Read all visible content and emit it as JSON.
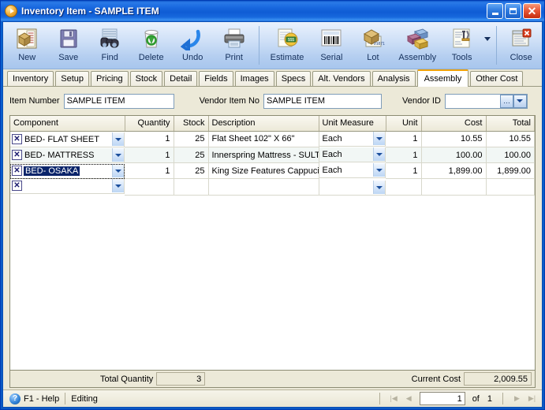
{
  "window": {
    "title": "Inventory Item - SAMPLE ITEM",
    "icon": "app-orange-play-icon",
    "buttons": {
      "minimize": "_",
      "maximize": "□",
      "close": "✕"
    }
  },
  "toolbar": {
    "items": [
      {
        "label": "New",
        "icon": "new-document-box-icon"
      },
      {
        "label": "Save",
        "icon": "floppy-disk-icon"
      },
      {
        "label": "Find",
        "icon": "binoculars-icon"
      },
      {
        "label": "Delete",
        "icon": "recycle-bin-icon"
      },
      {
        "label": "Undo",
        "icon": "undo-arrow-icon"
      },
      {
        "label": "Print",
        "icon": "printer-icon"
      },
      {
        "label": "Estimate",
        "icon": "estimate-money-icon"
      },
      {
        "label": "Serial",
        "icon": "barcode-icon"
      },
      {
        "label": "Lot",
        "icon": "lot-box-icon"
      },
      {
        "label": "Assembly",
        "icon": "assembly-blocks-icon"
      },
      {
        "label": "Tools",
        "icon": "tools-wrench-icon"
      },
      {
        "label": "Close",
        "icon": "close-window-icon"
      }
    ],
    "dropdown_caret": "chevron-down-icon"
  },
  "tabs": [
    {
      "label": "Inventory",
      "active": false
    },
    {
      "label": "Setup",
      "active": false
    },
    {
      "label": "Pricing",
      "active": false
    },
    {
      "label": "Stock",
      "active": false
    },
    {
      "label": "Detail",
      "active": false
    },
    {
      "label": "Fields",
      "active": false
    },
    {
      "label": "Images",
      "active": false
    },
    {
      "label": "Specs",
      "active": false
    },
    {
      "label": "Alt. Vendors",
      "active": false
    },
    {
      "label": "Analysis",
      "active": false
    },
    {
      "label": "Assembly",
      "active": true
    },
    {
      "label": "Other Cost",
      "active": false
    }
  ],
  "fields": {
    "item_number_label": "Item Number",
    "item_number_value": "SAMPLE ITEM",
    "vendor_item_label": "Vendor Item No",
    "vendor_item_value": "SAMPLE ITEM",
    "vendor_id_label": "Vendor ID",
    "vendor_id_value": "",
    "vendor_id_lookup": "…",
    "vendor_id_chevron": "chevron-down-icon"
  },
  "grid": {
    "columns": [
      {
        "label": "Component",
        "align": "left"
      },
      {
        "label": "Quantity",
        "align": "right"
      },
      {
        "label": "Stock",
        "align": "right"
      },
      {
        "label": "Description",
        "align": "left"
      },
      {
        "label": "Unit Measure",
        "align": "left"
      },
      {
        "label": "Unit",
        "align": "right"
      },
      {
        "label": "Cost",
        "align": "right"
      },
      {
        "label": "Total",
        "align": "right"
      }
    ],
    "delete_glyph": "✕",
    "rows": [
      {
        "component": "BED- FLAT SHEET",
        "quantity": "1",
        "stock": "25",
        "description": "Flat Sheet 102\" X 66\"",
        "unit_measure": "Each",
        "unit": "1",
        "cost": "10.55",
        "total": "10.55",
        "selected": false
      },
      {
        "component": "BED- MATTRESS",
        "quantity": "1",
        "stock": "25",
        "description": "Innerspring Mattress - SULTA",
        "unit_measure": "Each",
        "unit": "1",
        "cost": "100.00",
        "total": "100.00",
        "selected": false
      },
      {
        "component": "BED- OSAKA",
        "quantity": "1",
        "stock": "25",
        "description": "King Size Features Cappucino",
        "unit_measure": "Each",
        "unit": "1",
        "cost": "1,899.00",
        "total": "1,899.00",
        "selected": true
      },
      {
        "component": "",
        "quantity": "",
        "stock": "",
        "description": "",
        "unit_measure": "",
        "unit": "",
        "cost": "",
        "total": "",
        "selected": false
      }
    ]
  },
  "totals": {
    "total_quantity_label": "Total Quantity",
    "total_quantity_value": "3",
    "current_cost_label": "Current Cost",
    "current_cost_value": "2,009.55"
  },
  "statusbar": {
    "help_icon": "help-question-icon",
    "help_text": "F1 - Help",
    "mode_text": "Editing",
    "nav": {
      "first": "|◀",
      "prev": "◀",
      "page_value": "1",
      "of_text": "of",
      "total_pages": "1",
      "next": "▶",
      "last": "▶|"
    }
  },
  "colors": {
    "titlebar_blue": "#0f5cd4",
    "active_tab_accent": "#f0a30a",
    "selection_blue": "#0a246a",
    "face": "#ece9d8"
  }
}
